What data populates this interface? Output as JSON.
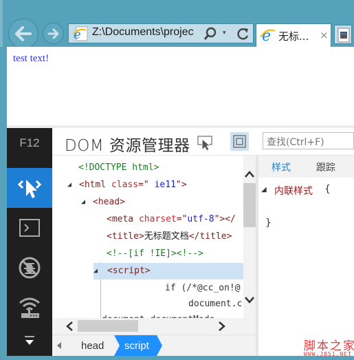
{
  "browser": {
    "address": "Z:\\Documents\\projec",
    "tab_title": "无标...",
    "tab_close": "×",
    "address_dropdown": "▾"
  },
  "page": {
    "text": "test text!"
  },
  "devtools": {
    "f12_label": "F12",
    "title": "DOM 资源管理器",
    "find_placeholder": "查找(Ctrl+F)",
    "tools": [
      {
        "name": "dom-explorer",
        "active": true
      },
      {
        "name": "console",
        "active": false
      },
      {
        "name": "debugger",
        "active": false
      },
      {
        "name": "network",
        "active": false
      },
      {
        "name": "more",
        "active": false
      }
    ],
    "dom_lines": {
      "doctype": "<!DOCTYPE html>",
      "html_open": "<html",
      "html_attr": "class",
      "html_eq": "=\"",
      "html_val": " ie11",
      "html_close": "\">",
      "head": "<head>",
      "meta_open": "<meta",
      "meta_attr": "charset",
      "meta_eq": "=\"",
      "meta_val": "utf-8",
      "meta_close": "\"></",
      "title_open": "<title>",
      "title_text": "无标题文档",
      "title_close": "</title>",
      "comment": "<!--[if !IE]><!-->",
      "script": "<script>",
      "code1": "if (/*@cc_on!@",
      "code2": "document.c",
      "code3": "document.documentMode"
    },
    "breadcrumbs": [
      "head",
      "script"
    ],
    "styles_tabs": [
      "样式",
      "跟踪"
    ],
    "inline_style_label": "内联样式",
    "brace_open": "{",
    "brace_close": "}"
  },
  "watermark": {
    "title": "脚本之家",
    "url": "WWW.JB51.NET"
  },
  "colors": {
    "chrome": "#56a2bb",
    "accent": "#1e7ed4",
    "tag": "#7d1f1f",
    "attr": "#d3232b",
    "value": "#1d1dcb",
    "comment": "#1a7e21"
  }
}
